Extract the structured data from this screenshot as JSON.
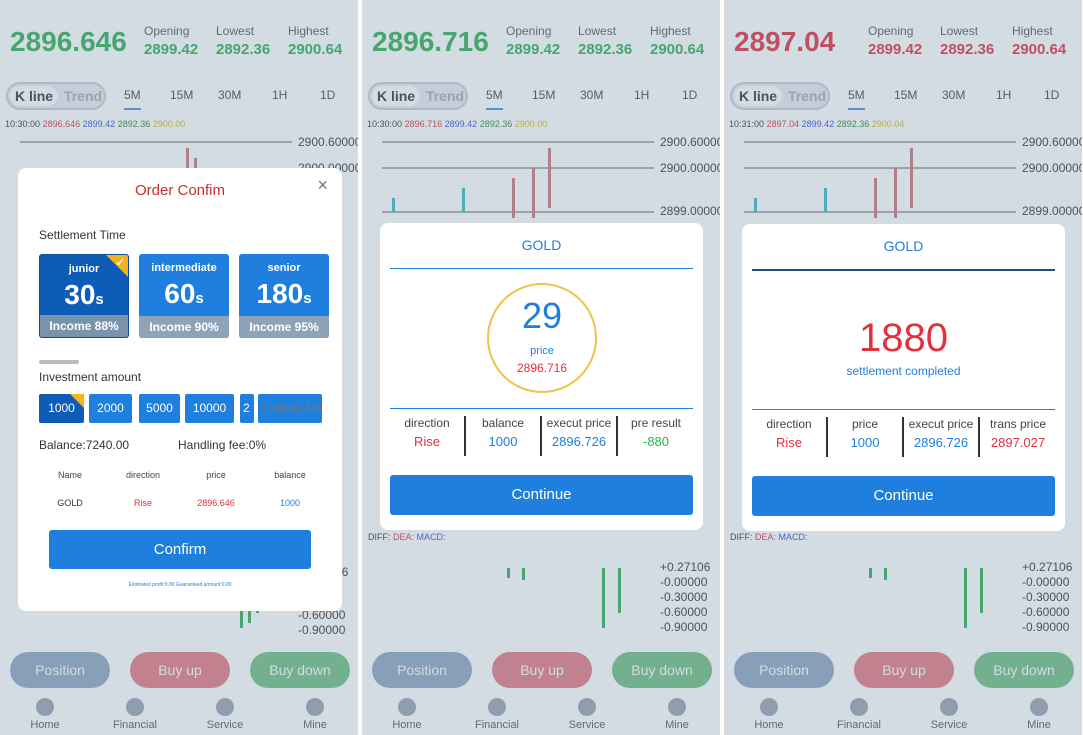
{
  "panels": [
    {
      "price": "2896.646",
      "price_color": "#2db04f",
      "opening_label": "Opening",
      "opening": "2899.42",
      "lowest_label": "Lowest",
      "lowest": "2892.36",
      "highest_label": "Highest",
      "highest": "2900.64",
      "stat_color": "#2db04f",
      "toggle_on": "K line",
      "toggle_off": "Trend",
      "periods": [
        "5M",
        "15M",
        "30M",
        "1H",
        "1D"
      ],
      "ohlc": {
        "time": "10:30:00",
        "a": "2896.646",
        "b": "2899.42",
        "c": "2892.36",
        "d": "2900.00"
      }
    },
    {
      "price": "2896.716",
      "price_color": "#2db04f",
      "opening_label": "Opening",
      "opening": "2899.42",
      "lowest_label": "Lowest",
      "lowest": "2892.36",
      "highest_label": "Highest",
      "highest": "2900.64",
      "stat_color": "#2db04f",
      "toggle_on": "K line",
      "toggle_off": "Trend",
      "periods": [
        "5M",
        "15M",
        "30M",
        "1H",
        "1D"
      ],
      "ohlc": {
        "time": "10:30:00",
        "a": "2896.716",
        "b": "2899.42",
        "c": "2892.36",
        "d": "2900.00"
      }
    },
    {
      "price": "2897.04",
      "price_color": "#e0313e",
      "opening_label": "Opening",
      "opening": "2899.42",
      "lowest_label": "Lowest",
      "lowest": "2892.36",
      "highest_label": "Highest",
      "highest": "2900.64",
      "stat_color": "#e0313e",
      "toggle_on": "K line",
      "toggle_off": "Trend",
      "periods": [
        "5M",
        "15M",
        "30M",
        "1H",
        "1D"
      ],
      "ohlc": {
        "time": "10:31:00",
        "a": "2897.04",
        "b": "2899.42",
        "c": "2892.36",
        "d": "2900.04"
      }
    }
  ],
  "axis": {
    "upper": [
      "2900.60000",
      "2900.00000",
      "2899.00000"
    ],
    "macd": [
      "+0.27106",
      "-0.00000",
      "-0.30000",
      "-0.60000",
      "-0.90000"
    ],
    "macd_legend": [
      "DIFF:",
      "DEA:",
      "MACD:"
    ],
    "left_tick": "01",
    "upper_partial": "00"
  },
  "actions": {
    "position": "Position",
    "buy_up": "Buy up",
    "buy_down": "Buy down"
  },
  "nav": [
    "Home",
    "Financial",
    "Service",
    "Mine"
  ],
  "order_confirm": {
    "title": "Order Confim",
    "close": "×",
    "settlement_label": "Settlement Time",
    "tiers": [
      {
        "name": "junior",
        "seconds": "30",
        "unit": "s",
        "income": "Income 88%"
      },
      {
        "name": "intermediate",
        "seconds": "60",
        "unit": "s",
        "income": "Income 90%"
      },
      {
        "name": "senior",
        "seconds": "180",
        "unit": "s",
        "income": "Income 95%"
      }
    ],
    "investment_label": "Investment amount",
    "amounts": [
      "1000",
      "2000",
      "5000",
      "10000",
      "2"
    ],
    "custom_placeholder": "Custom Am",
    "balance": "Balance:7240.00",
    "handling_fee": "Handling fee:0%",
    "table_headers": [
      "Name",
      "direction",
      "price",
      "balance"
    ],
    "table_row": [
      "GOLD",
      "Rise",
      "2896.646",
      "1000"
    ],
    "confirm_label": "Confirm",
    "footnote": "Estimated profit:0.00    Guaranteed amount:0.00"
  },
  "countdown": {
    "asset": "GOLD",
    "remaining": "29",
    "price_label": "price",
    "price": "2896.716",
    "headers": [
      "direction",
      "balance",
      "execut price",
      "pre result"
    ],
    "values": [
      "Rise",
      "1000",
      "2896.726",
      "-880"
    ],
    "continue_label": "Continue"
  },
  "settled": {
    "asset": "GOLD",
    "amount": "1880",
    "status": "settlement completed",
    "headers": [
      "direction",
      "price",
      "execut price",
      "trans price"
    ],
    "values": [
      "Rise",
      "1000",
      "2896.726",
      "2897.027"
    ],
    "continue_label": "Continue"
  },
  "colors": {
    "blue": "#1f7fde",
    "red": "#e0313e",
    "green": "#2db04f"
  }
}
